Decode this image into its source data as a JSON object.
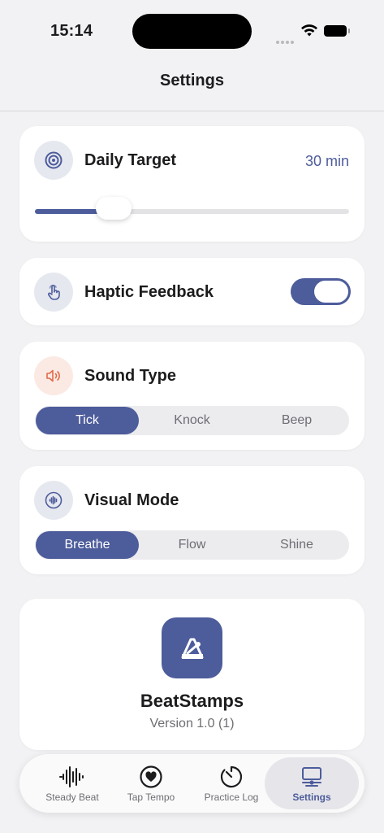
{
  "status_bar": {
    "time": "15:14"
  },
  "nav": {
    "title": "Settings"
  },
  "daily_target": {
    "title": "Daily Target",
    "value": "30 min",
    "slider_fraction": 0.2
  },
  "haptic": {
    "title": "Haptic Feedback",
    "enabled": true
  },
  "sound_type": {
    "title": "Sound Type",
    "options": [
      "Tick",
      "Knock",
      "Beep"
    ],
    "selected": "Tick"
  },
  "visual_mode": {
    "title": "Visual Mode",
    "options": [
      "Breathe",
      "Flow",
      "Shine"
    ],
    "selected": "Breathe"
  },
  "about": {
    "app_name": "BeatStamps",
    "version": "Version 1.0 (1)"
  },
  "tabbar": {
    "tabs": [
      {
        "label": "Steady Beat",
        "icon": "waveform-icon"
      },
      {
        "label": "Tap Tempo",
        "icon": "heart-icon"
      },
      {
        "label": "Practice Log",
        "icon": "timer-icon"
      },
      {
        "label": "Settings",
        "icon": "laptop-settings-icon"
      }
    ],
    "active": "Settings"
  },
  "colors": {
    "accent": "#4d5c9b",
    "background": "#f2f2f4",
    "orange_icon": "#e06a4a"
  }
}
